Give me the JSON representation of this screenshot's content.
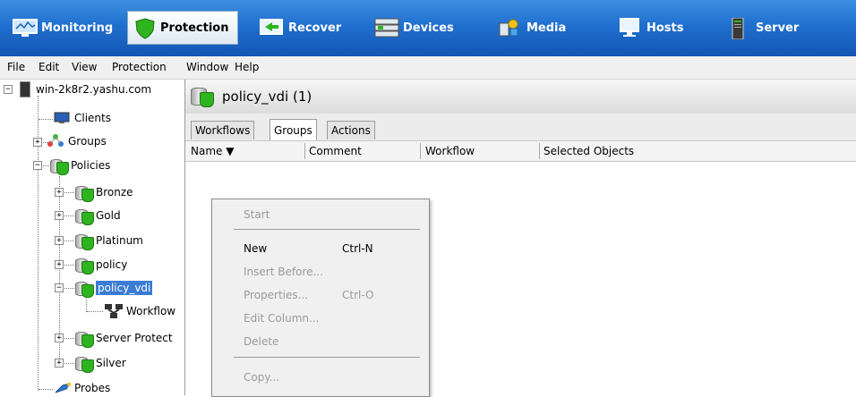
{
  "modules": [
    {
      "label": "Monitoring",
      "icon": "monitor-icon"
    },
    {
      "label": "Protection",
      "icon": "shield-icon",
      "active": true
    },
    {
      "label": "Recover",
      "icon": "recover-icon"
    },
    {
      "label": "Devices",
      "icon": "devices-icon"
    },
    {
      "label": "Media",
      "icon": "media-icon"
    },
    {
      "label": "Hosts",
      "icon": "hosts-icon"
    },
    {
      "label": "Server",
      "icon": "server-icon"
    }
  ],
  "menu": [
    "File",
    "Edit",
    "View",
    "Protection",
    "Window",
    "Help"
  ],
  "tree": {
    "root": "win-2k8r2.yashu.com",
    "clients": "Clients",
    "groups": "Groups",
    "policies": "Policies",
    "policy_items": [
      "Bronze",
      "Gold",
      "Platinum",
      "policy",
      "policy_vdi"
    ],
    "workflow": "Workflow",
    "policy_items_after": [
      "Server Protect",
      "Silver"
    ],
    "probes": "Probes"
  },
  "panel": {
    "title": "policy_vdi (1)",
    "tabs": [
      "Workflows",
      "Groups",
      "Actions"
    ],
    "active_tab": "Groups",
    "columns": [
      "Name ▼",
      "Comment",
      "Workflow",
      "Selected Objects"
    ]
  },
  "context_menu": {
    "start": "Start",
    "new": "New",
    "new_shortcut": "Ctrl-N",
    "insert_before": "Insert Before...",
    "properties": "Properties...",
    "properties_shortcut": "Ctrl-O",
    "edit_column": "Edit Column...",
    "delete": "Delete",
    "copy": "Copy..."
  },
  "colors": {
    "topbar": "#1f6fcf",
    "selection": "#3a7bd5",
    "shield": "#2fb41f"
  }
}
